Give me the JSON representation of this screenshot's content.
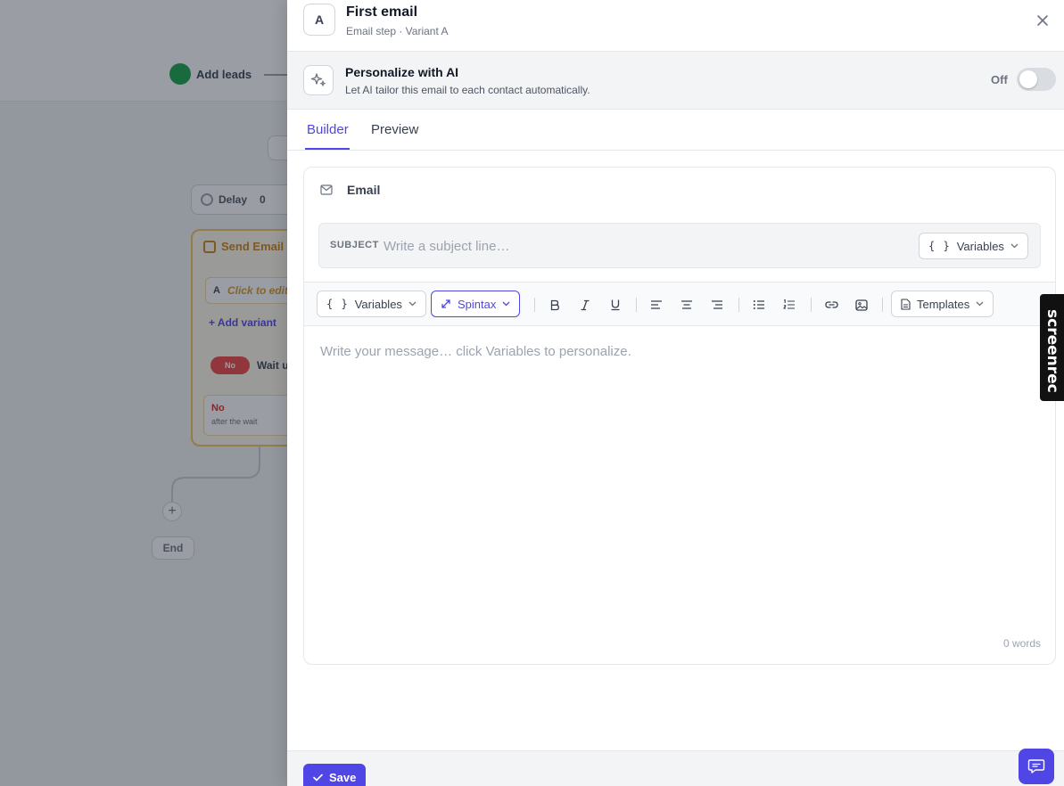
{
  "background": {
    "add_leads_label": "Add leads",
    "delay_label": "Delay",
    "delay_value": "0",
    "send_email_label": "Send Email",
    "variant_letter": "A",
    "variant_placeholder": "Click to edit",
    "add_variant_label": "+ Add variant",
    "no_badge": "No",
    "wait_label": "Wait u",
    "no_branch_title": "No",
    "no_branch_sub": "after the wait",
    "plus_label": "+",
    "end_label": "End"
  },
  "header": {
    "badge": "A",
    "title": "First email",
    "subtitle": "Email step · Variant A"
  },
  "ai": {
    "title": "Personalize with AI",
    "description": "Let AI tailor this email to each contact automatically.",
    "state_label": "Off",
    "enabled": false
  },
  "tabs": [
    {
      "label": "Builder",
      "active": true
    },
    {
      "label": "Preview",
      "active": false
    }
  ],
  "email": {
    "section_title": "Email",
    "subject_label": "SUBJECT",
    "subject_value": "",
    "subject_placeholder": "Write a subject line…",
    "variables_label": "Variables",
    "variables_brace": "{ }"
  },
  "toolbar": {
    "variables_label": "Variables",
    "variables_brace": "{ }",
    "spintax_label": "Spintax",
    "templates_label": "Templates",
    "tools": [
      "bold-icon",
      "italic-icon",
      "underline-icon",
      "align-left-icon",
      "align-center-icon",
      "align-right-icon",
      "bullet-list-icon",
      "numbered-list-icon",
      "link-icon",
      "image-icon"
    ]
  },
  "editor": {
    "placeholder": "Write your message…  click Variables to personalize.",
    "word_count": "0 words"
  },
  "footer": {
    "save_label": "Save"
  },
  "watermark": {
    "text": "screenrec"
  },
  "colors": {
    "accent": "#4f46e5",
    "overlay": "#1f2532"
  }
}
